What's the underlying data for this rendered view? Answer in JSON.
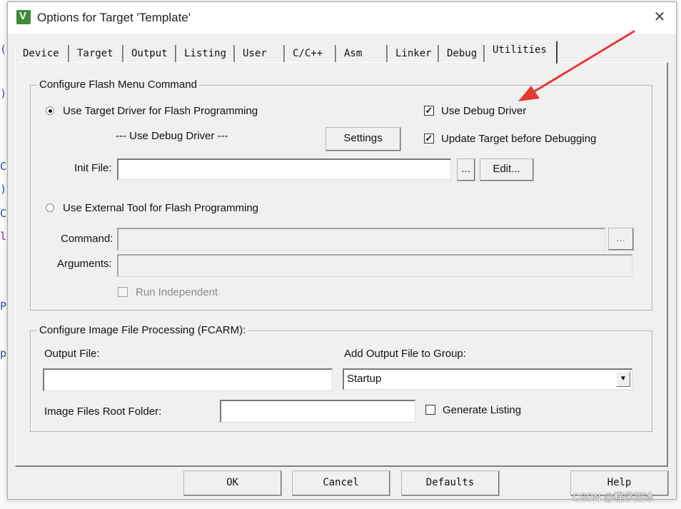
{
  "window": {
    "title": "Options for Target 'Template'",
    "icon": "keil-uvision-icon",
    "close_glyph": "✕"
  },
  "background_glyphs": [
    "(",
    ")",
    "C",
    ")",
    "C",
    "l",
    "P",
    "p"
  ],
  "tabs": [
    {
      "label": "Device"
    },
    {
      "label": "Target"
    },
    {
      "label": "Output"
    },
    {
      "label": "Listing"
    },
    {
      "label": "User"
    },
    {
      "label": "C/C++"
    },
    {
      "label": "Asm"
    },
    {
      "label": "Linker"
    },
    {
      "label": "Debug"
    },
    {
      "label": "Utilities",
      "active": true
    }
  ],
  "flash": {
    "legend": "Configure Flash Menu Command",
    "radio_target_label": "Use Target Driver for Flash Programming",
    "radio_target_checked": true,
    "driver_text": "--- Use Debug Driver ---",
    "settings_label": "Settings",
    "use_debug_driver_label": "Use Debug Driver",
    "use_debug_driver_checked": true,
    "update_target_label": "Update Target before Debugging",
    "update_target_checked": true,
    "init_file_label": "Init File:",
    "init_file_value": "",
    "browse_label": "...",
    "edit_label": "Edit...",
    "radio_external_label": "Use External Tool for Flash Programming",
    "radio_external_checked": false,
    "command_label": "Command:",
    "command_value": "",
    "command_browse_label": "...",
    "arguments_label": "Arguments:",
    "arguments_value": "",
    "run_independent_label": "Run Independent",
    "run_independent_checked": false
  },
  "image": {
    "legend": "Configure Image File Processing (FCARM):",
    "output_file_label": "Output File:",
    "output_file_value": "",
    "add_output_label": "Add Output File  to Group:",
    "group_value": "Startup",
    "root_folder_label": "Image Files Root Folder:",
    "root_folder_value": "",
    "generate_listing_label": "Generate Listing",
    "generate_listing_checked": false
  },
  "buttons": {
    "ok": "OK",
    "cancel": "Cancel",
    "defaults": "Defaults",
    "help": "Help"
  },
  "annotation": {
    "arrow_color": "#e53935",
    "arrow_target": "Use Debug Driver"
  },
  "watermark": "CSDN @程序加冰",
  "colors": {
    "dialog_bg": "#f0f0f0",
    "title_bg": "#ffffff",
    "icon_green": "#3c8a3a"
  }
}
